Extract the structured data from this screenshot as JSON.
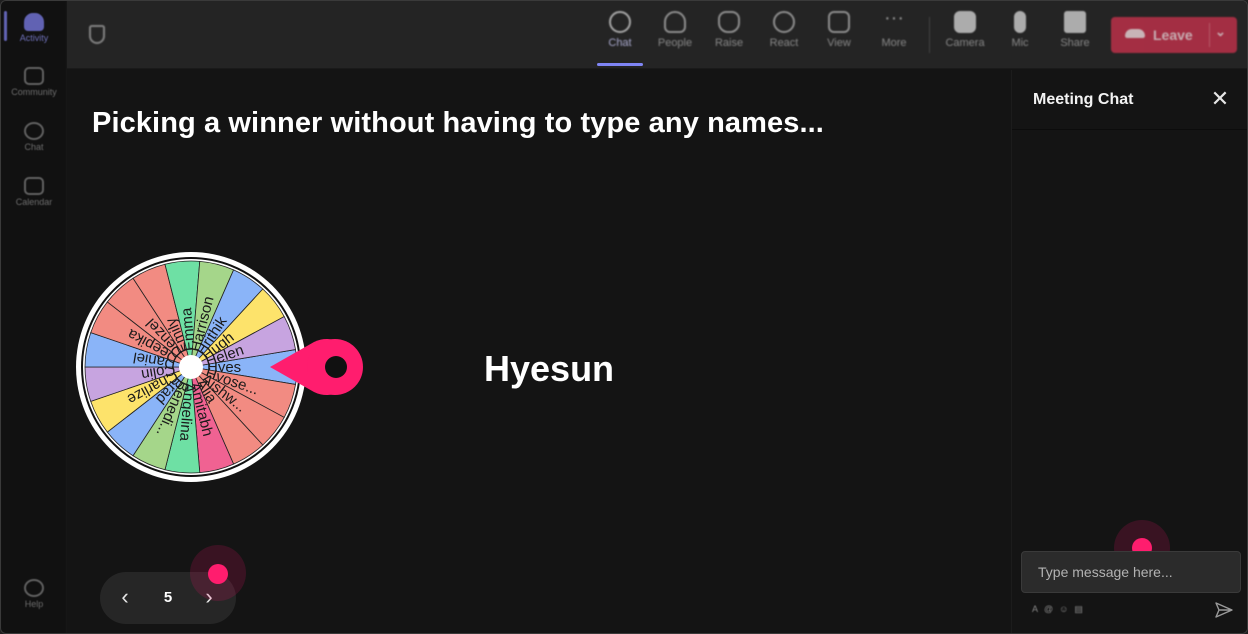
{
  "colors": {
    "accent": "#7f85f5",
    "leave": "#c4314b",
    "pointer": "#ff1d6e",
    "background": "#141414"
  },
  "rail": {
    "items": [
      {
        "label": "Activity",
        "icon": "bell-icon",
        "active": true
      },
      {
        "label": "Community",
        "icon": "community-icon"
      },
      {
        "label": "Chat",
        "icon": "chat-icon"
      },
      {
        "label": "Calendar",
        "icon": "calendar-icon"
      }
    ],
    "help": "Help"
  },
  "toolbar": {
    "items": [
      {
        "label": "Chat",
        "icon": "chat-icon",
        "active": true
      },
      {
        "label": "People",
        "icon": "people-icon"
      },
      {
        "label": "Raise",
        "icon": "raise-hand-icon"
      },
      {
        "label": "React",
        "icon": "smile-icon"
      },
      {
        "label": "View",
        "icon": "grid-icon"
      },
      {
        "label": "More",
        "icon": "more-dots-icon"
      },
      {
        "label": "Camera",
        "icon": "camera-off-icon"
      },
      {
        "label": "Mic",
        "icon": "mic-icon"
      },
      {
        "label": "Share",
        "icon": "share-icon"
      }
    ],
    "leave": "Leave"
  },
  "slide": {
    "title": "Picking a winner without having to type any names...",
    "winner": "Hyesun",
    "page": "5"
  },
  "wheel": {
    "names": [
      "Hyes",
      "Hyose...",
      "Aishw...",
      "Alia",
      "Amitabh",
      "Angelina",
      "Benedi...",
      "Brad",
      "Charlize",
      "Colin",
      "Daniel",
      "Deepika",
      "Denzel",
      "Emily",
      "Emma",
      "Harrison",
      "Hrithik",
      "Hugh",
      "Helen"
    ],
    "colors": [
      "#8ab4f8",
      "#f28b82",
      "#f28b82",
      "#f28b82",
      "#f06292",
      "#6ee0a4",
      "#a5d68a",
      "#8ab4f8",
      "#fde36b",
      "#c7a4e0",
      "#8ab4f8",
      "#f28b82",
      "#f28b82",
      "#f28b82",
      "#6ee0a4",
      "#a5d68a",
      "#8ab4f8",
      "#fde36b",
      "#c7a4e0"
    ]
  },
  "chat": {
    "title": "Meeting Chat",
    "placeholder": "Type message here...",
    "close_icon": "close-icon",
    "send_icon": "send-icon"
  }
}
